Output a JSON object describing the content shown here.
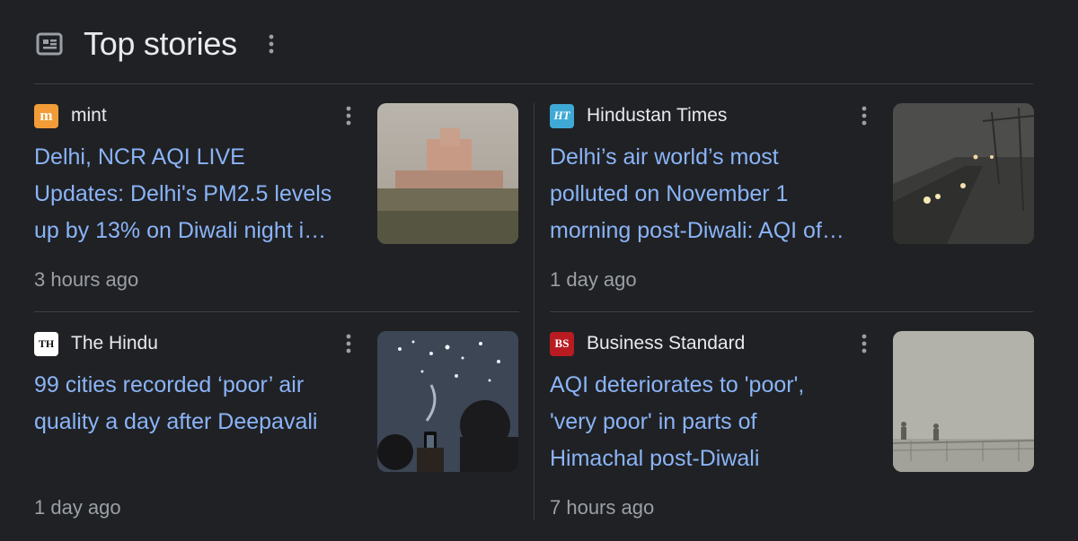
{
  "header": {
    "title": "Top stories"
  },
  "stories": [
    {
      "source": "mint",
      "headline_lines": [
        "Delhi, NCR AQI LIVE",
        "Updates: Delhi's PM2.5 levels",
        "up by 13% on Diwali night i…"
      ],
      "time": "3 hours ago",
      "logo_text": "m",
      "logo_color": "#f29c38"
    },
    {
      "source": "Hindustan Times",
      "headline_lines": [
        "Delhi’s air world’s most",
        "polluted on November 1",
        "morning post-Diwali: AQI of…"
      ],
      "time": "1 day ago",
      "logo_text": "HT",
      "logo_color": "#3fa9d6"
    },
    {
      "source": "The Hindu",
      "headline_lines": [
        "99 cities recorded ‘poor’ air",
        "quality a day after Deepavali"
      ],
      "time": "1 day ago",
      "logo_text": "TH",
      "logo_color": "#ffffff"
    },
    {
      "source": "Business Standard",
      "headline_lines": [
        "AQI deteriorates to 'poor',",
        "'very poor' in parts of",
        "Himachal post-Diwali"
      ],
      "time": "7 hours ago",
      "logo_text": "BS",
      "logo_color": "#b81c22"
    }
  ]
}
